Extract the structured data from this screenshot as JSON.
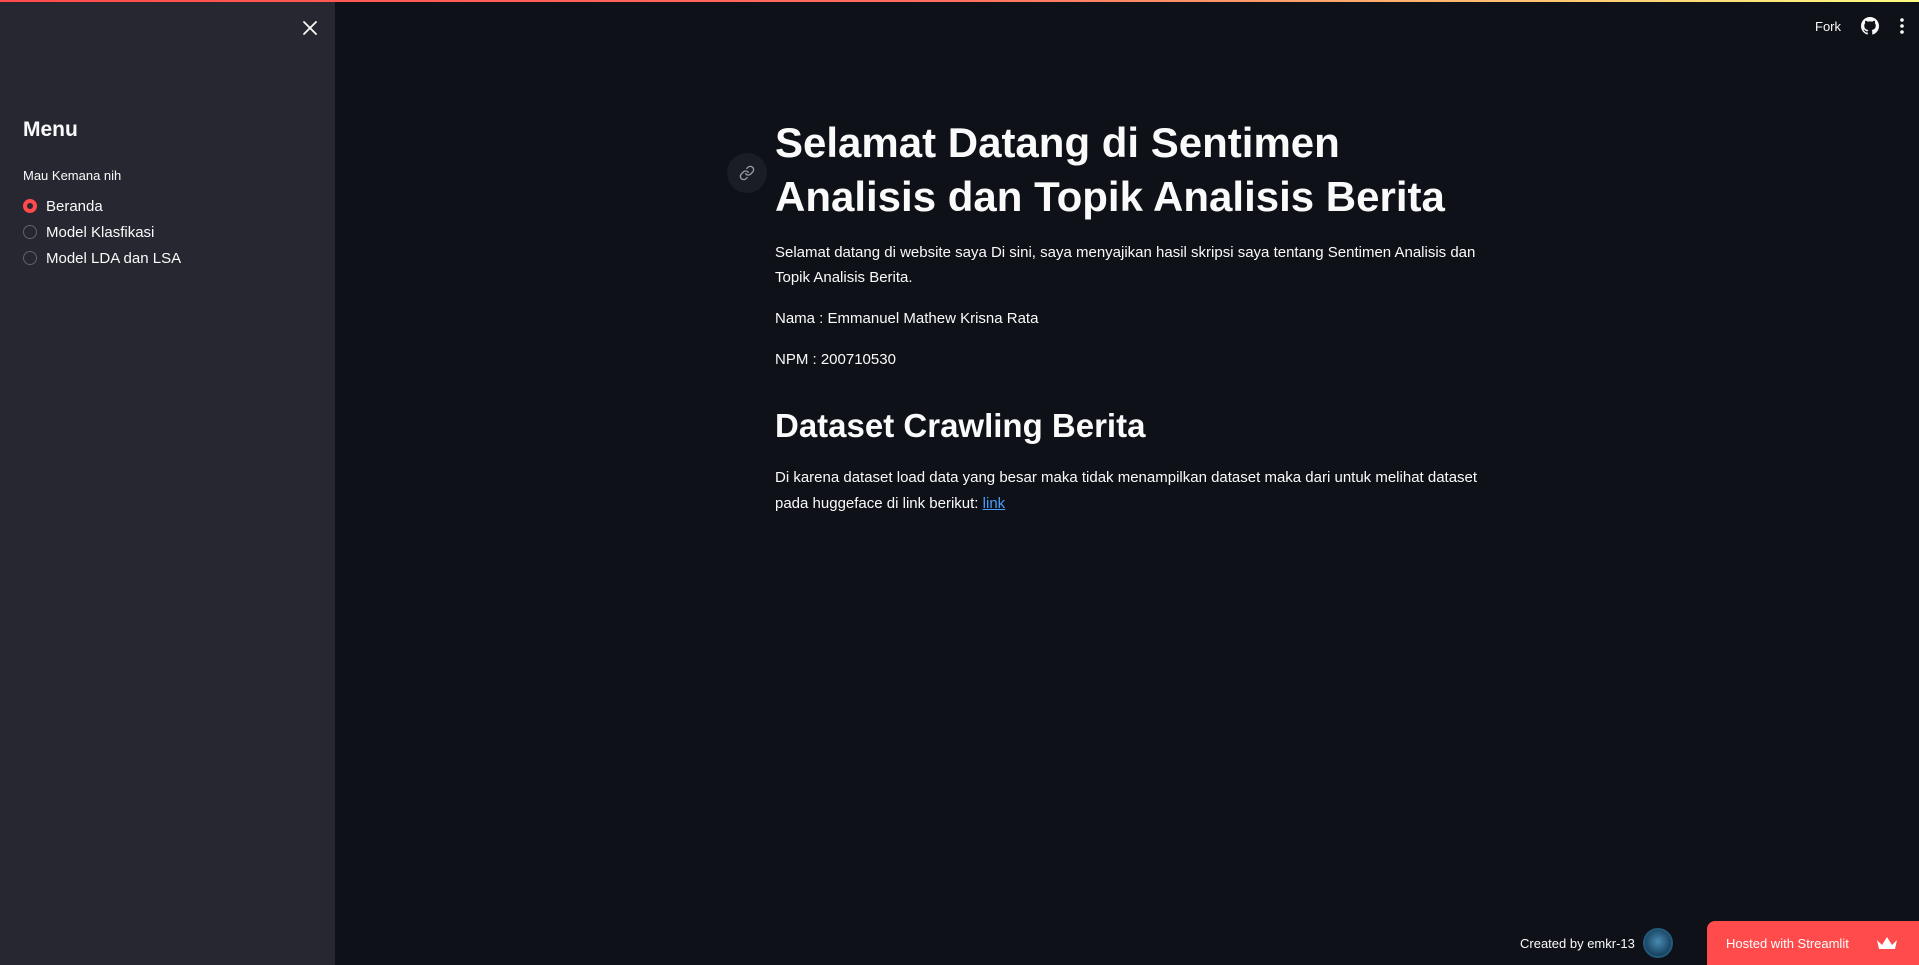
{
  "sidebar": {
    "title": "Menu",
    "radio_group_label": "Mau Kemana nih",
    "options": [
      {
        "label": "Beranda",
        "selected": true
      },
      {
        "label": "Model Klasfikasi",
        "selected": false
      },
      {
        "label": "Model LDA dan LSA",
        "selected": false
      }
    ]
  },
  "toolbar": {
    "fork_label": "Fork"
  },
  "main": {
    "title": "Selamat Datang di Sentimen Analisis dan Topik Analisis Berita",
    "intro": "Selamat datang di website saya Di sini, saya menyajikan hasil skripsi saya tentang Sentimen Analisis dan Topik Analisis Berita.",
    "nama": "Nama : Emmanuel Mathew Krisna Rata",
    "npm": "NPM : 200710530",
    "section_heading": "Dataset Crawling Berita",
    "dataset_text": "Di karena dataset load data yang besar maka tidak menampilkan dataset maka dari untuk melihat dataset pada huggeface di link berikut: ",
    "dataset_link_label": "link"
  },
  "footer": {
    "created_by": "Created by emkr-13",
    "hosted_label": "Hosted with Streamlit"
  },
  "colors": {
    "accent": "#ff4b4b",
    "background": "#0e1117",
    "sidebar_bg": "#262730",
    "link": "#4a9dff"
  },
  "icons": [
    "close-icon",
    "github-icon",
    "more-vertical-icon",
    "link-icon",
    "crown-icon"
  ]
}
